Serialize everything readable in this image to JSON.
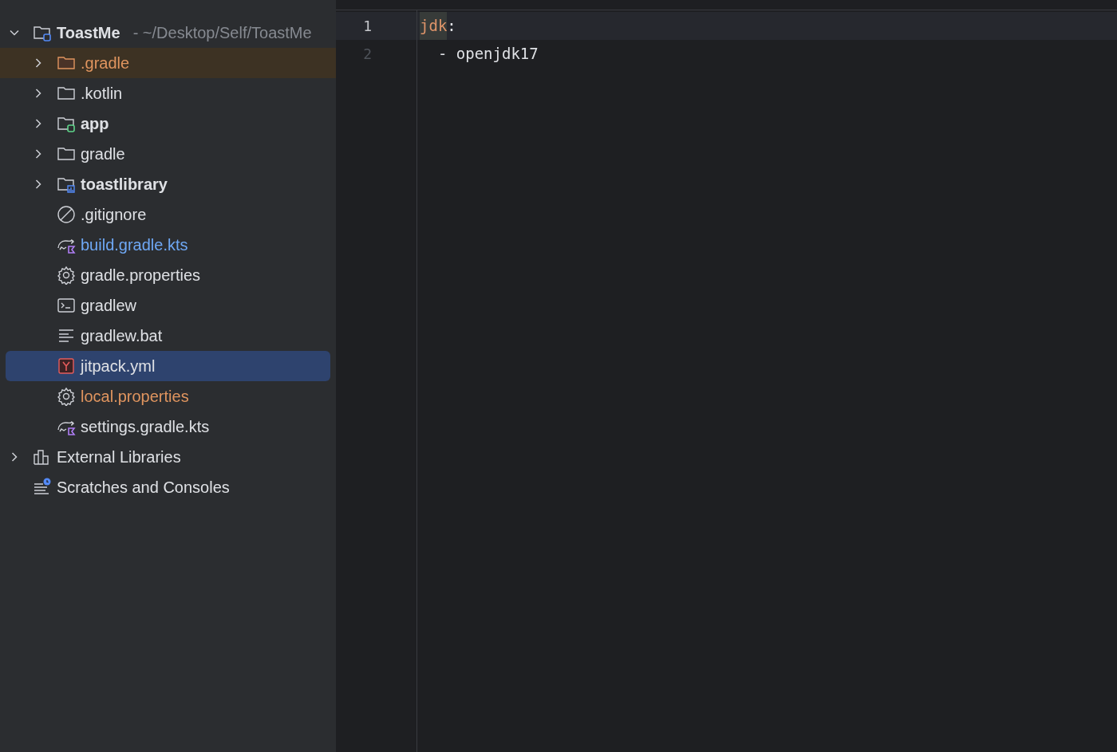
{
  "project_tree": [
    {
      "label": "ToastMe",
      "bold": true,
      "hint": "- ~/Desktop/Self/ToastMe",
      "kind": "project",
      "expanded": true,
      "selected": false,
      "highlighted": false,
      "color": "#dfe1e5",
      "children": [
        {
          "label": ".gradle",
          "bold": false,
          "kind": "folder",
          "expanded": false,
          "selected": false,
          "highlighted": true,
          "color": "#e0955f"
        },
        {
          "label": ".kotlin",
          "bold": false,
          "kind": "folder",
          "expanded": false,
          "selected": false,
          "highlighted": false,
          "color": "#dfe1e5"
        },
        {
          "label": "app",
          "bold": true,
          "kind": "module",
          "expanded": false,
          "selected": false,
          "highlighted": false,
          "color": "#dfe1e5"
        },
        {
          "label": "gradle",
          "bold": false,
          "kind": "folder",
          "expanded": false,
          "selected": false,
          "highlighted": false,
          "color": "#dfe1e5"
        },
        {
          "label": "toastlibrary",
          "bold": true,
          "kind": "library",
          "expanded": false,
          "selected": false,
          "highlighted": false,
          "color": "#dfe1e5"
        },
        {
          "label": ".gitignore",
          "bold": false,
          "kind": "ignore",
          "selected": false,
          "highlighted": false,
          "color": "#dfe1e5"
        },
        {
          "label": "build.gradle.kts",
          "bold": false,
          "kind": "script",
          "selected": false,
          "highlighted": false,
          "color": "#6fa8f5"
        },
        {
          "label": "gradle.properties",
          "bold": false,
          "kind": "settings",
          "selected": false,
          "highlighted": false,
          "color": "#dfe1e5"
        },
        {
          "label": "gradlew",
          "bold": false,
          "kind": "terminal",
          "selected": false,
          "highlighted": false,
          "color": "#dfe1e5"
        },
        {
          "label": "gradlew.bat",
          "bold": false,
          "kind": "text",
          "selected": false,
          "highlighted": false,
          "color": "#dfe1e5"
        },
        {
          "label": "jitpack.yml",
          "bold": false,
          "kind": "yaml",
          "selected": true,
          "highlighted": false,
          "color": "#dfe1e5"
        },
        {
          "label": "local.properties",
          "bold": false,
          "kind": "settings",
          "selected": false,
          "highlighted": false,
          "color": "#e0955f"
        },
        {
          "label": "settings.gradle.kts",
          "bold": false,
          "kind": "script",
          "selected": false,
          "highlighted": false,
          "color": "#dfe1e5"
        }
      ]
    },
    {
      "label": "External Libraries",
      "bold": false,
      "kind": "libraries",
      "expanded": false,
      "selected": false,
      "highlighted": false,
      "color": "#dfe1e5"
    },
    {
      "label": "Scratches and Consoles",
      "bold": false,
      "kind": "scratches",
      "selected": false,
      "highlighted": false,
      "color": "#dfe1e5"
    }
  ],
  "editor": {
    "lines": [
      {
        "number": "1",
        "current": true,
        "tokens": [
          {
            "text": "jdk",
            "kind": "key",
            "highlighted": true
          },
          {
            "text": ":",
            "kind": "punct",
            "highlighted": false
          }
        ]
      },
      {
        "number": "2",
        "current": false,
        "tokens": [
          {
            "text": "  - openjdk17",
            "kind": "plain",
            "highlighted": false
          }
        ]
      }
    ]
  }
}
